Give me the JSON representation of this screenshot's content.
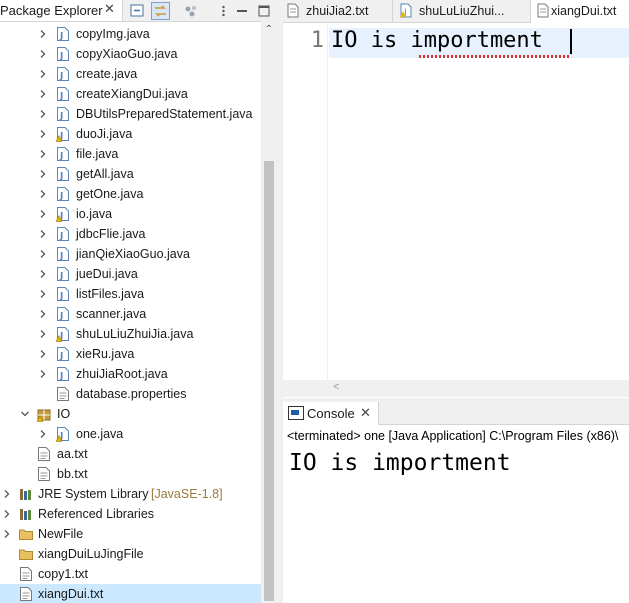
{
  "package_explorer": {
    "title": "Package Explorer",
    "close_glyph": "✕",
    "toolbar": [
      {
        "name": "collapse-all-icon",
        "active": false
      },
      {
        "name": "link-with-editor-icon",
        "active": true
      },
      {
        "name": "focus-icon",
        "active": false
      },
      {
        "name": "view-menu-icon",
        "active": false
      },
      {
        "name": "minimize-icon",
        "active": false
      },
      {
        "name": "maximize-icon",
        "active": false
      }
    ],
    "scroll_up_glyph": "⌃",
    "tree": [
      {
        "label": "copyImg.java",
        "icon": "java-file-icon",
        "level": 2,
        "expand": "closed",
        "warn": false
      },
      {
        "label": "copyXiaoGuo.java",
        "icon": "java-file-icon",
        "level": 2,
        "expand": "closed",
        "warn": false
      },
      {
        "label": "create.java",
        "icon": "java-file-icon",
        "level": 2,
        "expand": "closed",
        "warn": false
      },
      {
        "label": "createXiangDui.java",
        "icon": "java-file-icon",
        "level": 2,
        "expand": "closed",
        "warn": false
      },
      {
        "label": "DBUtilsPreparedStatement.java",
        "icon": "java-file-icon",
        "level": 2,
        "expand": "closed",
        "warn": false
      },
      {
        "label": "duoJi.java",
        "icon": "java-file-icon",
        "level": 2,
        "expand": "closed",
        "warn": true
      },
      {
        "label": "file.java",
        "icon": "java-file-icon",
        "level": 2,
        "expand": "closed",
        "warn": false
      },
      {
        "label": "getAll.java",
        "icon": "java-file-icon",
        "level": 2,
        "expand": "closed",
        "warn": false
      },
      {
        "label": "getOne.java",
        "icon": "java-file-icon",
        "level": 2,
        "expand": "closed",
        "warn": false
      },
      {
        "label": "io.java",
        "icon": "java-file-icon",
        "level": 2,
        "expand": "closed",
        "warn": true
      },
      {
        "label": "jdbcFlie.java",
        "icon": "java-file-icon",
        "level": 2,
        "expand": "closed",
        "warn": false
      },
      {
        "label": "jianQieXiaoGuo.java",
        "icon": "java-file-icon",
        "level": 2,
        "expand": "closed",
        "warn": false
      },
      {
        "label": "jueDui.java",
        "icon": "java-file-icon",
        "level": 2,
        "expand": "closed",
        "warn": false
      },
      {
        "label": "listFiles.java",
        "icon": "java-file-icon",
        "level": 2,
        "expand": "closed",
        "warn": false
      },
      {
        "label": "scanner.java",
        "icon": "java-file-icon",
        "level": 2,
        "expand": "closed",
        "warn": false
      },
      {
        "label": "shuLuLiuZhuiJia.java",
        "icon": "java-file-icon",
        "level": 2,
        "expand": "closed",
        "warn": true
      },
      {
        "label": "xieRu.java",
        "icon": "java-file-icon",
        "level": 2,
        "expand": "closed",
        "warn": false
      },
      {
        "label": "zhuiJiaRoot.java",
        "icon": "java-file-icon",
        "level": 2,
        "expand": "closed",
        "warn": false
      },
      {
        "label": "database.properties",
        "icon": "properties-file-icon",
        "level": 2,
        "expand": "none",
        "warn": false
      },
      {
        "label": "IO",
        "icon": "package-icon",
        "level": 1,
        "expand": "open",
        "warn": true
      },
      {
        "label": "one.java",
        "icon": "java-file-icon",
        "level": 2,
        "expand": "closed",
        "warn": true
      },
      {
        "label": "aa.txt",
        "icon": "text-file-icon",
        "level": 1,
        "expand": "none",
        "warn": false
      },
      {
        "label": "bb.txt",
        "icon": "text-file-icon",
        "level": 1,
        "expand": "none",
        "warn": false
      },
      {
        "label": "JRE System Library",
        "decoration": "[JavaSE-1.8]",
        "icon": "library-icon",
        "level": 0,
        "expand": "closed",
        "warn": false
      },
      {
        "label": "Referenced Libraries",
        "icon": "library-icon",
        "level": 0,
        "expand": "closed",
        "warn": false
      },
      {
        "label": "NewFile",
        "icon": "folder-icon",
        "level": 0,
        "expand": "closed",
        "warn": false
      },
      {
        "label": "xiangDuiLuJingFile",
        "icon": "folder-icon",
        "level": 0,
        "expand": "none",
        "warn": false
      },
      {
        "label": "copy1.txt",
        "icon": "text-file-icon",
        "level": 0,
        "expand": "none",
        "warn": false
      },
      {
        "label": "xiangDui.txt",
        "icon": "text-file-icon",
        "level": 0,
        "expand": "none",
        "warn": false,
        "selected": true
      }
    ]
  },
  "editor": {
    "tabs": [
      {
        "label": "zhuiJia2.txt",
        "icon": "text-file-icon",
        "warn": false,
        "active": false
      },
      {
        "label": "shuLuLiuZhui...",
        "icon": "java-file-icon",
        "warn": true,
        "active": false
      },
      {
        "label": "xiangDui.txt",
        "icon": "text-file-icon",
        "warn": false,
        "active": true
      }
    ],
    "line_number": "1",
    "content": "IO is importment",
    "scroll_left_glyph": "<"
  },
  "console": {
    "title": "Console",
    "close_glyph": "✕",
    "status": "<terminated> one [Java Application] C:\\Program Files (x86)\\",
    "output": "IO is importment"
  },
  "colors": {
    "selection": "#cce8ff",
    "current_line": "#e8f2fe",
    "java_icon": "#5b84b8",
    "package_icon": "#c89b3c",
    "folder_icon": "#e8c060",
    "warning": "#e8b400",
    "decoration": "#9a7a3a"
  }
}
